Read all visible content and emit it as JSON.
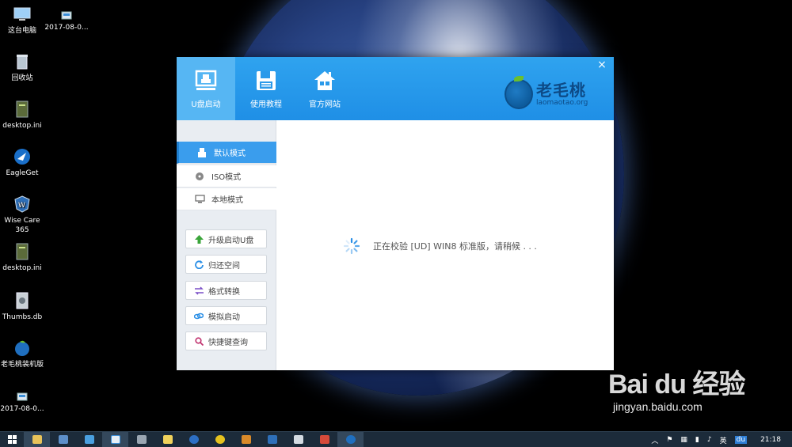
{
  "desktop": {
    "icons": [
      {
        "label": "这台电脑",
        "icon": "computer-icon"
      },
      {
        "label": "2017-08-0...",
        "icon": "folder-image-icon"
      },
      {
        "label": "回收站",
        "icon": "recycle-bin-icon"
      },
      {
        "label": "desktop.ini",
        "icon": "ini-file-icon"
      },
      {
        "label": "EagleGet",
        "icon": "eagleget-icon"
      },
      {
        "label": "Wise Care 365",
        "icon": "wisecare-icon"
      },
      {
        "label": "desktop.ini",
        "icon": "ini-file-icon"
      },
      {
        "label": "Thumbs.db",
        "icon": "db-file-icon"
      },
      {
        "label": "老毛桃装机版",
        "icon": "laomaotao-icon"
      },
      {
        "label": "2017-08-0...",
        "icon": "folder-image-icon"
      }
    ]
  },
  "window": {
    "tabs": [
      {
        "label": "U盘启动",
        "icon": "usb-boot-icon"
      },
      {
        "label": "使用教程",
        "icon": "floppy-icon"
      },
      {
        "label": "官方网站",
        "icon": "home-icon"
      }
    ],
    "close": "×",
    "logo": {
      "cn": "老毛桃",
      "en": "laomaotao.org"
    },
    "modes": [
      {
        "label": "默认模式",
        "icon": "usb-icon"
      },
      {
        "label": "ISO模式",
        "icon": "disc-icon"
      },
      {
        "label": "本地模式",
        "icon": "monitor-icon"
      }
    ],
    "tools": [
      {
        "label": "升级启动U盘",
        "icon": "arrow-up-icon"
      },
      {
        "label": "归还空间",
        "icon": "refresh-icon"
      },
      {
        "label": "格式转换",
        "icon": "swap-icon"
      },
      {
        "label": "模拟启动",
        "icon": "link-icon"
      },
      {
        "label": "快捷键查询",
        "icon": "search-icon"
      }
    ],
    "status_text": "正在校验 [UD] WIN8 标准版，请稍候 . . ."
  },
  "taskbar": {
    "tray": {
      "lang": "英",
      "time": "21:18"
    }
  },
  "watermark": {
    "logo": "Bai du 经验",
    "sub": "jingyan.baidu.com"
  },
  "colors": {
    "header": "#1f8fe6",
    "active_tab": "#56b6f3",
    "active_mode": "#3a9ded",
    "taskbar": "#1c2b3a"
  }
}
